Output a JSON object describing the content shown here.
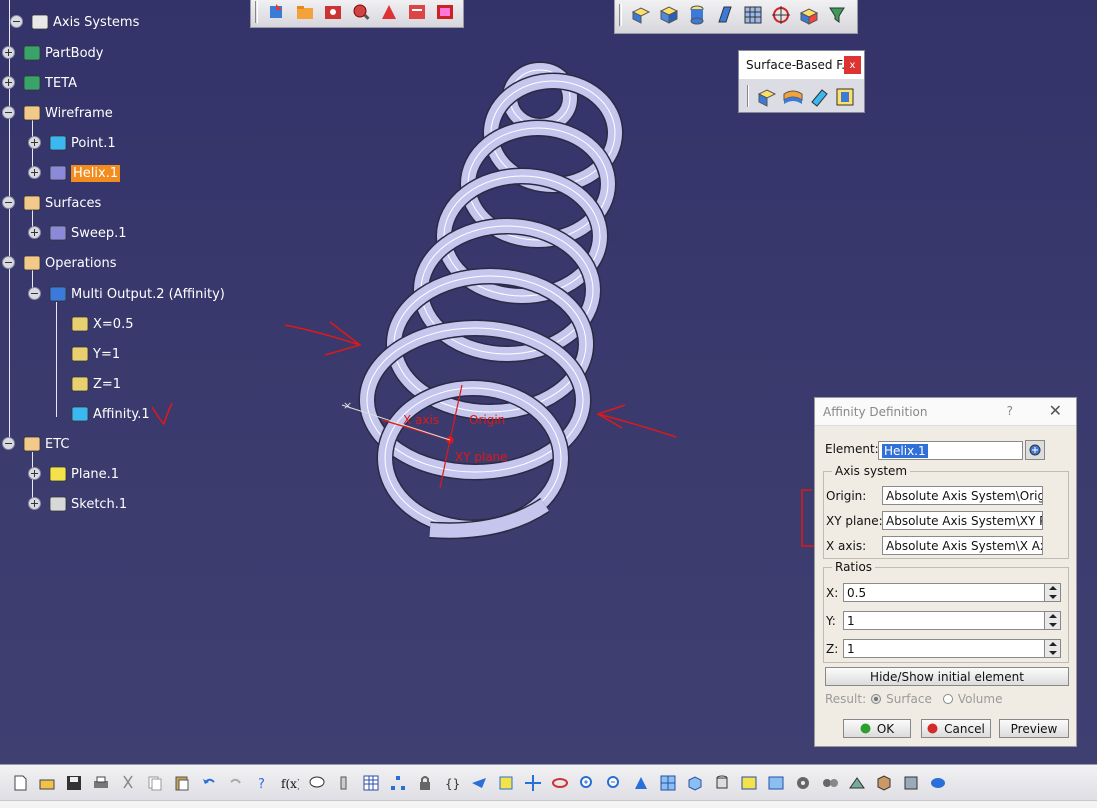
{
  "tree": {
    "items": [
      {
        "label": "Axis Systems",
        "icon": "axis-system-icon"
      },
      {
        "label": "PartBody",
        "icon": "gear-icon"
      },
      {
        "label": "TETA",
        "icon": "gear-icon"
      },
      {
        "label": "Wireframe",
        "icon": "geometrical-set-icon"
      },
      {
        "label": "Point.1",
        "icon": "point-icon"
      },
      {
        "label": "Helix.1",
        "icon": "helix-icon",
        "selected": true
      },
      {
        "label": "Surfaces",
        "icon": "geometrical-set-icon"
      },
      {
        "label": "Sweep.1",
        "icon": "sweep-icon"
      },
      {
        "label": "Operations",
        "icon": "geometrical-set-icon"
      },
      {
        "label": "Multi Output.2 (Affinity)",
        "icon": "multi-output-icon"
      },
      {
        "label": "X=0.5",
        "icon": "parameter-icon"
      },
      {
        "label": "Y=1",
        "icon": "parameter-icon"
      },
      {
        "label": "Z=1",
        "icon": "parameter-icon"
      },
      {
        "label": "Affinity.1",
        "icon": "affinity-icon",
        "annotation": "V"
      },
      {
        "label": "ETC",
        "icon": "geometrical-set-icon"
      },
      {
        "label": "Plane.1",
        "icon": "plane-icon"
      },
      {
        "label": "Sketch.1",
        "icon": "sketch-icon"
      }
    ]
  },
  "viewport_labels": {
    "x_axis": "X axis",
    "origin": "Origin",
    "xy_plane": "XY plane"
  },
  "floating_toolbar": {
    "title": "Surface-Based F...",
    "close_label": "x"
  },
  "dialog": {
    "title": "Affinity Definition",
    "help": "?",
    "close": "✕",
    "element_label": "Element:",
    "element_value": "Helix.1",
    "axis_group": "Axis system",
    "origin_label": "Origin:",
    "origin_value": "Absolute Axis System\\Origin",
    "xy_label": "XY plane:",
    "xy_value": "Absolute Axis System\\XY Plane",
    "xaxis_label": "X axis:",
    "xaxis_value": "Absolute Axis System\\X Axis",
    "ratios_group": "Ratios",
    "x_label": "X:",
    "x_value": "0.5",
    "y_label": "Y:",
    "y_value": "1",
    "z_label": "Z:",
    "z_value": "1",
    "hide_show": "Hide/Show initial element",
    "result_label": "Result:",
    "surface_label": "Surface",
    "volume_label": "Volume",
    "ok": "OK",
    "cancel": "Cancel",
    "preview": "Preview"
  },
  "colors": {
    "background": "#353564",
    "selection": "#f28c1e",
    "annotation": "#e01818",
    "helix": "#c4c6ee"
  }
}
